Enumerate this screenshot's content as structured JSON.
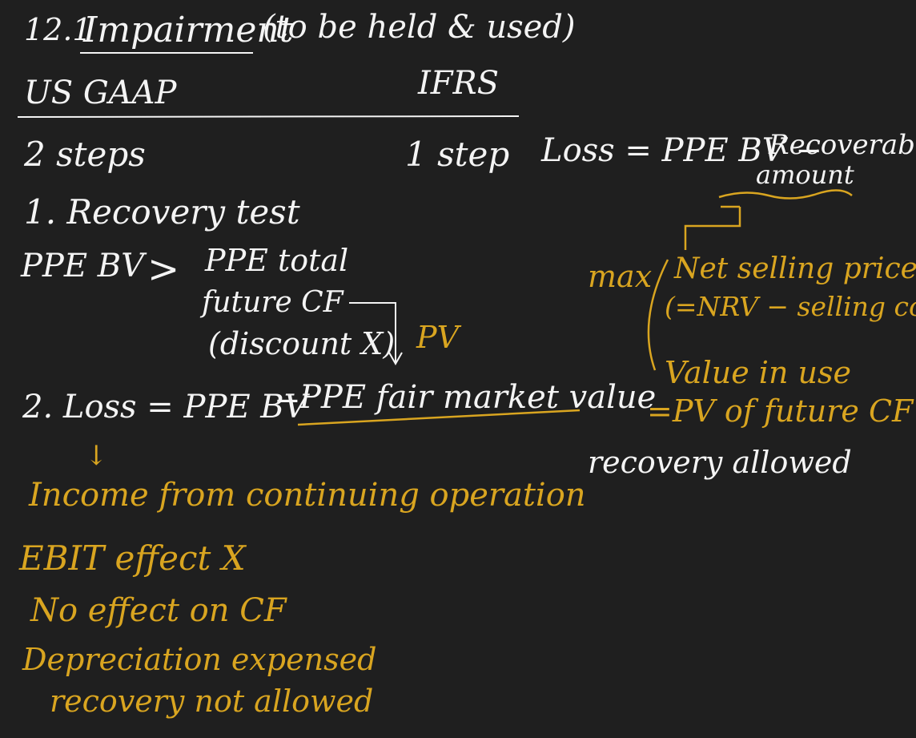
{
  "colors": {
    "background": "#1f1f1f",
    "white_ink": "#f4f4f4",
    "yellow_ink": "#d9a520"
  },
  "title": {
    "number": "12.1",
    "word": "Impairment",
    "qualifier": "(to be held & used)"
  },
  "columns": {
    "us_gaap": "US GAAP",
    "ifrs": "IFRS"
  },
  "us_gaap": {
    "steps": "2 steps",
    "step1": "1. Recovery test",
    "compare_lhs": "PPE BV",
    "compare_op": ">",
    "compare_rhs_1": "PPE total",
    "compare_rhs_2": "future CF",
    "compare_rhs_3": "(discount X)",
    "pv_note": "PV",
    "step2_lhs": "2. Loss = PPE BV",
    "step2_dash": "−",
    "step2_rhs": "PPE fair market value",
    "arrow": "↓",
    "effects": [
      "Income from continuing operation",
      "EBIT effect X",
      "No effect on CF",
      "Depreciation expensed",
      "recovery not allowed"
    ]
  },
  "ifrs": {
    "steps": "1 step",
    "loss_formula": "Loss = PPE BV −",
    "recoverable_1": "Recoverable",
    "recoverable_2": "amount",
    "max_label": "max",
    "option1_line1": "Net selling price",
    "option1_line2": "(=NRV − selling cost)",
    "option2_line1": "Value in use",
    "option2_line2": "=PV of future CF",
    "recovery": "recovery allowed"
  }
}
